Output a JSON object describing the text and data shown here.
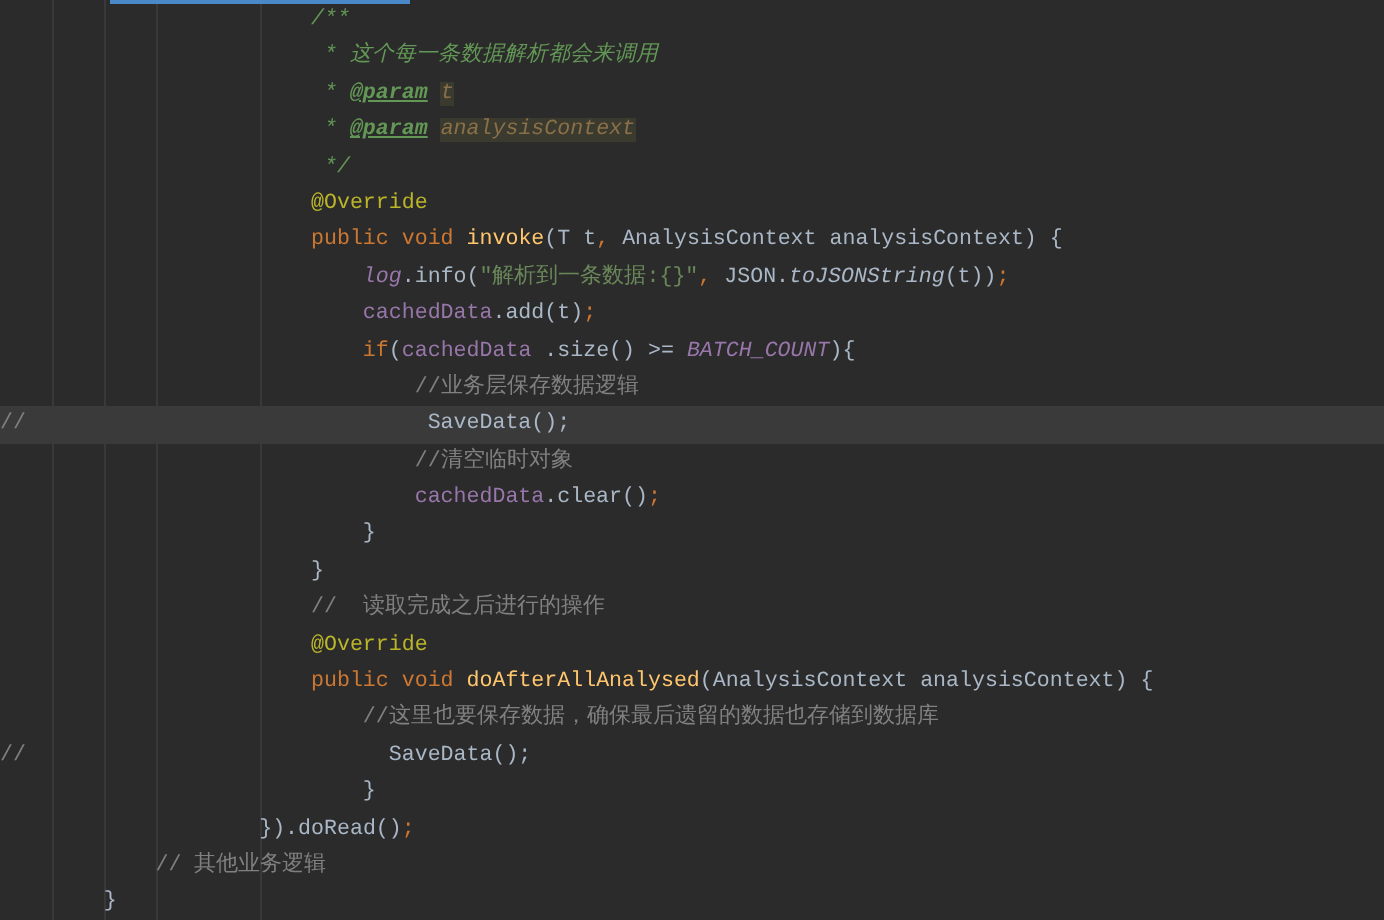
{
  "editor": {
    "lines": [
      {
        "current": false,
        "tokens": [
          {
            "text": "                        /**",
            "kind": "doc"
          }
        ]
      },
      {
        "current": false,
        "tokens": [
          {
            "text": "                         * 这个每一条数据解析都会来调用",
            "kind": "doc"
          }
        ]
      },
      {
        "current": false,
        "tokens": [
          {
            "text": "                         * ",
            "kind": "doc"
          },
          {
            "text": "@param",
            "kind": "doc-tag"
          },
          {
            "text": " t",
            "kind": "doc-param"
          }
        ]
      },
      {
        "current": false,
        "tokens": [
          {
            "text": "                         * ",
            "kind": "doc"
          },
          {
            "text": "@param",
            "kind": "doc-tag"
          },
          {
            "text": " analysisContext",
            "kind": "doc-param"
          }
        ]
      },
      {
        "current": false,
        "tokens": [
          {
            "text": "                         */",
            "kind": "doc"
          }
        ]
      },
      {
        "current": false,
        "tokens": [
          {
            "text": "                        @Override",
            "kind": "annotation"
          }
        ]
      },
      {
        "current": false,
        "tokens": [
          {
            "text": "                        public void ",
            "kind": "keyword"
          },
          {
            "text": "invoke",
            "kind": "method"
          },
          {
            "text": "(T t",
            "kind": "plain"
          },
          {
            "text": ", ",
            "kind": "keyword"
          },
          {
            "text": "AnalysisContext analysisContext) {",
            "kind": "plain"
          }
        ]
      },
      {
        "current": false,
        "tokens": [
          {
            "text": "                            log",
            "kind": "field-static"
          },
          {
            "text": ".info(",
            "kind": "plain"
          },
          {
            "text": "\"解析到一条数据:{}\"",
            "kind": "string"
          },
          {
            "text": ", ",
            "kind": "keyword"
          },
          {
            "text": "JSON.",
            "kind": "plain"
          },
          {
            "text": "toJSONString",
            "kind": "call-static"
          },
          {
            "text": "(t))",
            "kind": "plain"
          },
          {
            "text": ";",
            "kind": "keyword"
          }
        ]
      },
      {
        "current": false,
        "tokens": [
          {
            "text": "                            cachedData",
            "kind": "field"
          },
          {
            "text": ".add(t)",
            "kind": "plain"
          },
          {
            "text": ";",
            "kind": "keyword"
          }
        ]
      },
      {
        "current": false,
        "tokens": [
          {
            "text": "                            if",
            "kind": "keyword"
          },
          {
            "text": "(",
            "kind": "plain"
          },
          {
            "text": "cachedData",
            "kind": "field"
          },
          {
            "text": " .size() >= ",
            "kind": "plain"
          },
          {
            "text": "BATCH_COUNT",
            "kind": "field-static"
          },
          {
            "text": "){",
            "kind": "plain"
          }
        ]
      },
      {
        "current": false,
        "tokens": [
          {
            "text": "                                //业务层保存数据逻辑",
            "kind": "comment"
          }
        ]
      },
      {
        "current": true,
        "tokens": [
          {
            "text": "//",
            "kind": "comment"
          },
          {
            "text": "                               SaveData();",
            "kind": "plain"
          }
        ]
      },
      {
        "current": false,
        "tokens": [
          {
            "text": "                                //清空临时对象",
            "kind": "comment"
          }
        ]
      },
      {
        "current": false,
        "tokens": [
          {
            "text": "                                cachedData",
            "kind": "field"
          },
          {
            "text": ".clear()",
            "kind": "plain"
          },
          {
            "text": ";",
            "kind": "keyword"
          }
        ]
      },
      {
        "current": false,
        "tokens": [
          {
            "text": "                            }",
            "kind": "plain"
          }
        ]
      },
      {
        "current": false,
        "tokens": [
          {
            "text": "                        }",
            "kind": "plain"
          }
        ]
      },
      {
        "current": false,
        "tokens": [
          {
            "text": "                        //  读取完成之后进行的操作",
            "kind": "comment"
          }
        ]
      },
      {
        "current": false,
        "tokens": [
          {
            "text": "                        @Override",
            "kind": "annotation"
          }
        ]
      },
      {
        "current": false,
        "tokens": [
          {
            "text": "                        public void ",
            "kind": "keyword"
          },
          {
            "text": "doAfterAllAnalysed",
            "kind": "method"
          },
          {
            "text": "(AnalysisContext analysisContext) {",
            "kind": "plain"
          }
        ]
      },
      {
        "current": false,
        "tokens": [
          {
            "text": "                            //这里也要保存数据，确保最后遗留的数据也存储到数据库",
            "kind": "comment"
          }
        ]
      },
      {
        "current": false,
        "tokens": [
          {
            "text": "//",
            "kind": "comment"
          },
          {
            "text": "                            SaveData();",
            "kind": "plain"
          }
        ]
      },
      {
        "current": false,
        "tokens": [
          {
            "text": "                            }",
            "kind": "plain"
          }
        ]
      },
      {
        "current": false,
        "tokens": [
          {
            "text": "                    }).",
            "kind": "plain"
          },
          {
            "text": "doRead()",
            "kind": "plain"
          },
          {
            "text": ";",
            "kind": "keyword"
          }
        ]
      },
      {
        "current": false,
        "tokens": [
          {
            "text": "            // 其他业务逻辑",
            "kind": "comment"
          }
        ]
      },
      {
        "current": false,
        "tokens": [
          {
            "text": "        }",
            "kind": "plain"
          }
        ]
      }
    ]
  }
}
